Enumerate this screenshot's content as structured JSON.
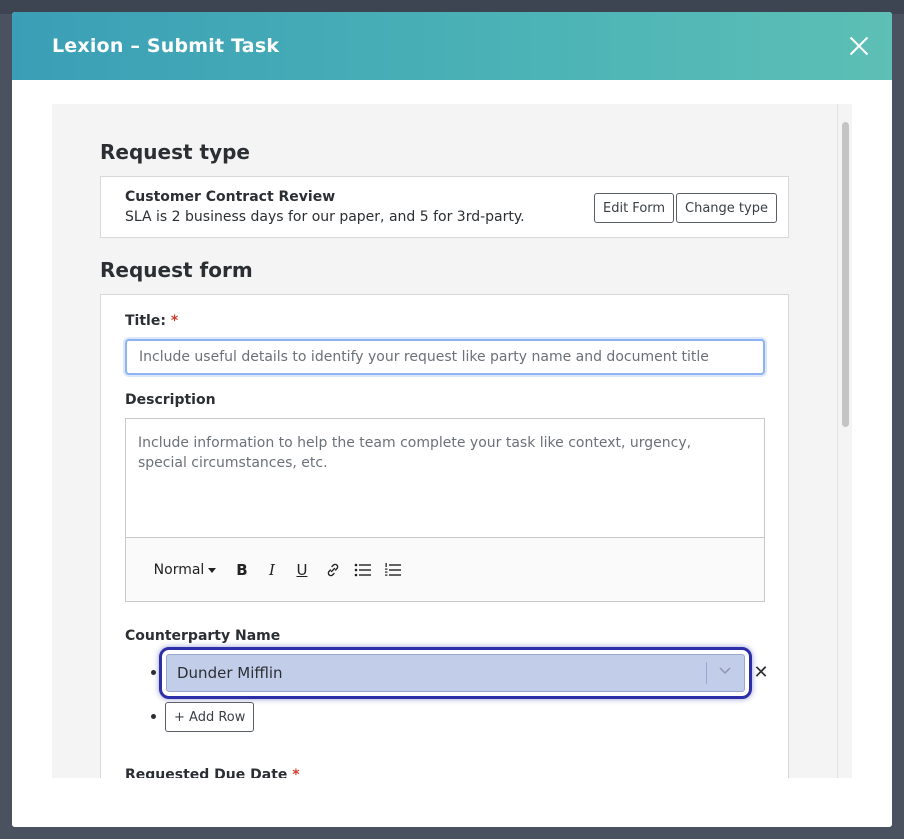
{
  "modal": {
    "title": "Lexion – Submit Task"
  },
  "request_type": {
    "heading": "Request type",
    "name": "Customer Contract Review",
    "description": "SLA is 2 business days for our paper, and 5 for 3rd-party.",
    "edit_form_label": "Edit Form",
    "change_type_label": "Change type"
  },
  "request_form": {
    "heading": "Request form",
    "title_label": "Title:",
    "required_mark": "*",
    "title_placeholder": "Include useful details to identify your request like party name and document title",
    "description_label": "Description",
    "description_placeholder": "Include information to help the team complete your task like context, urgency, special circumstances, etc.",
    "toolbar": {
      "format_label": "Normal",
      "bold": "B",
      "italic": "I",
      "underline": "U"
    },
    "counterparty_label": "Counterparty Name",
    "counterparty_value": "Dunder Mifflin",
    "remove_symbol": "✕",
    "add_row_label": "+ Add Row",
    "due_date_label": "Requested Due Date"
  },
  "colors": {
    "header_start": "#3a9fb6",
    "header_end": "#5dbfb5",
    "focus_ring": "#2c2fa8",
    "select_fill": "#c2cdea",
    "required": "#d43a2a"
  },
  "icons": [
    "close-icon",
    "link-icon",
    "bulleted-list-icon",
    "numbered-list-icon",
    "chevron-down-icon",
    "remove-icon"
  ]
}
